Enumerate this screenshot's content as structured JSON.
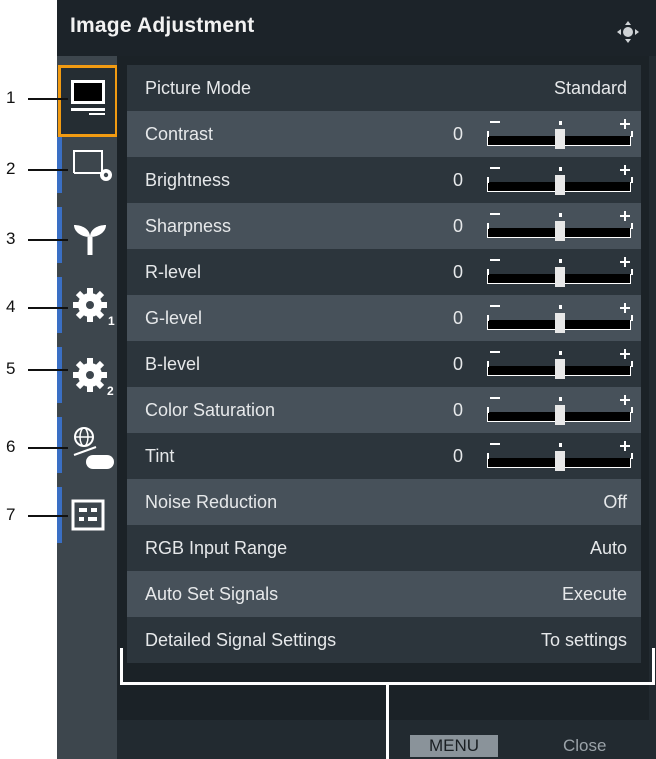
{
  "window": {
    "title": "Image Adjustment",
    "nav_icon": "directional-pad-icon"
  },
  "callouts": [
    "1",
    "2",
    "3",
    "4",
    "5",
    "6",
    "7"
  ],
  "tabs": [
    {
      "name": "tab-image-adjustment",
      "icon": "monitor-icon"
    },
    {
      "name": "tab-screen-settings",
      "icon": "screen-gear-icon"
    },
    {
      "name": "tab-eco",
      "icon": "sprout-icon"
    },
    {
      "name": "tab-settings-1",
      "icon": "gear-1-icon"
    },
    {
      "name": "tab-settings-2",
      "icon": "gear-2-icon"
    },
    {
      "name": "tab-network-usb",
      "icon": "globe-usb-icon"
    },
    {
      "name": "tab-information",
      "icon": "info-panel-icon"
    }
  ],
  "rows": [
    {
      "label": "Picture Mode",
      "value": "Standard"
    },
    {
      "label": "Contrast",
      "number": "0",
      "slider": 0.5
    },
    {
      "label": "Brightness",
      "number": "0",
      "slider": 0.5
    },
    {
      "label": "Sharpness",
      "number": "0",
      "slider": 0.5
    },
    {
      "label": "R-level",
      "number": "0",
      "slider": 0.5
    },
    {
      "label": "G-level",
      "number": "0",
      "slider": 0.5
    },
    {
      "label": "B-level",
      "number": "0",
      "slider": 0.5
    },
    {
      "label": "Color Saturation",
      "number": "0",
      "slider": 0.5
    },
    {
      "label": "Tint",
      "number": "0",
      "slider": 0.5
    },
    {
      "label": "Noise Reduction",
      "value": "Off"
    },
    {
      "label": "RGB Input Range",
      "value": "Auto"
    },
    {
      "label": "Auto Set Signals",
      "value": "Execute"
    },
    {
      "label": "Detailed Signal Settings",
      "value": "To settings"
    }
  ],
  "footer": {
    "menu_label": "MENU",
    "close_label": "Close"
  },
  "colors": {
    "active_tab": "#f29b12",
    "tab_accent": "#3a6fc4"
  }
}
